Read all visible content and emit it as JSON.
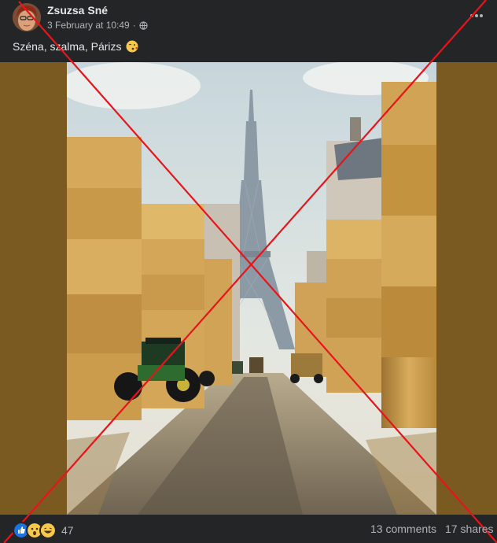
{
  "post": {
    "author": "Zsuzsa Sné",
    "timestamp": "3 February at 10:49",
    "audience_icon": "globe-icon",
    "caption": "Széna, szalma, Párizs",
    "caption_emoji": "winking-kiss-emoji"
  },
  "footer": {
    "reactions": [
      "like",
      "wow",
      "haha"
    ],
    "reaction_count": "47",
    "comments": "13 comments",
    "shares": "17 shares"
  },
  "overlay": {
    "type": "red-x-cross",
    "color": "#e8141b"
  },
  "colors": {
    "background": "#242526",
    "text": "#e4e6eb",
    "secondary_text": "#b0b3b8",
    "media_border": "#7b5a22"
  }
}
